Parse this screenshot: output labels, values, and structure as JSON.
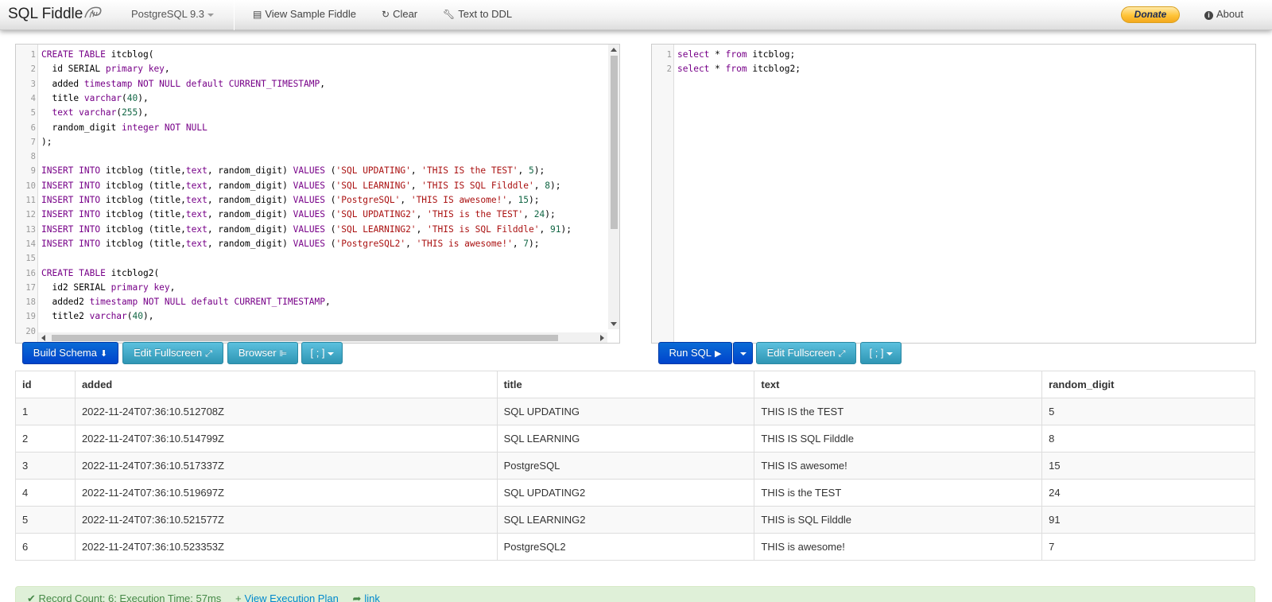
{
  "navbar": {
    "brand": "SQL Fiddle",
    "db_version": "PostgreSQL 9.3",
    "view_sample": "View Sample Fiddle",
    "clear": "Clear",
    "text_to_ddl": "Text to DDL",
    "donate": "Donate",
    "about": "About"
  },
  "schema_editor": {
    "lines": [
      {
        "n": "1",
        "t": [
          [
            "kw",
            "CREATE TABLE "
          ],
          [
            "",
            "itcblog("
          ]
        ]
      },
      {
        "n": "2",
        "t": [
          [
            "",
            "  id SERIAL "
          ],
          [
            "kw",
            "primary key"
          ],
          [
            "",
            ","
          ]
        ]
      },
      {
        "n": "3",
        "t": [
          [
            "",
            "  added "
          ],
          [
            "kw",
            "timestamp NOT NULL default CURRENT_TIMESTAMP"
          ],
          [
            "",
            ","
          ]
        ]
      },
      {
        "n": "4",
        "t": [
          [
            "",
            "  title "
          ],
          [
            "kw",
            "varchar"
          ],
          [
            "",
            "("
          ],
          [
            "nm",
            "40"
          ],
          [
            "",
            "),"
          ]
        ]
      },
      {
        "n": "5",
        "t": [
          [
            "",
            "  "
          ],
          [
            "kw",
            "text varchar"
          ],
          [
            "",
            "("
          ],
          [
            "nm",
            "255"
          ],
          [
            "",
            "),"
          ]
        ]
      },
      {
        "n": "6",
        "t": [
          [
            "",
            "  random_digit "
          ],
          [
            "kw",
            "integer NOT NULL"
          ]
        ]
      },
      {
        "n": "7",
        "t": [
          [
            "",
            ");"
          ]
        ]
      },
      {
        "n": "8",
        "t": [
          [
            "",
            ""
          ]
        ]
      },
      {
        "n": "9",
        "t": [
          [
            "kw",
            "INSERT INTO "
          ],
          [
            "",
            "itcblog (title,"
          ],
          [
            "kw",
            "text"
          ],
          [
            "",
            ", random_digit) "
          ],
          [
            "kw",
            "VALUES "
          ],
          [
            "",
            "("
          ],
          [
            "st",
            "'SQL UPDATING'"
          ],
          [
            "",
            ", "
          ],
          [
            "st",
            "'THIS IS the TEST'"
          ],
          [
            "",
            ", "
          ],
          [
            "nm",
            "5"
          ],
          [
            "",
            ");"
          ]
        ]
      },
      {
        "n": "10",
        "t": [
          [
            "kw",
            "INSERT INTO "
          ],
          [
            "",
            "itcblog (title,"
          ],
          [
            "kw",
            "text"
          ],
          [
            "",
            ", random_digit) "
          ],
          [
            "kw",
            "VALUES "
          ],
          [
            "",
            "("
          ],
          [
            "st",
            "'SQL LEARNING'"
          ],
          [
            "",
            ", "
          ],
          [
            "st",
            "'THIS IS SQL Filddle'"
          ],
          [
            "",
            ", "
          ],
          [
            "nm",
            "8"
          ],
          [
            "",
            ");"
          ]
        ]
      },
      {
        "n": "11",
        "t": [
          [
            "kw",
            "INSERT INTO "
          ],
          [
            "",
            "itcblog (title,"
          ],
          [
            "kw",
            "text"
          ],
          [
            "",
            ", random_digit) "
          ],
          [
            "kw",
            "VALUES "
          ],
          [
            "",
            "("
          ],
          [
            "st",
            "'PostgreSQL'"
          ],
          [
            "",
            ", "
          ],
          [
            "st",
            "'THIS IS awesome!'"
          ],
          [
            "",
            ", "
          ],
          [
            "nm",
            "15"
          ],
          [
            "",
            ");"
          ]
        ]
      },
      {
        "n": "12",
        "t": [
          [
            "kw",
            "INSERT INTO "
          ],
          [
            "",
            "itcblog (title,"
          ],
          [
            "kw",
            "text"
          ],
          [
            "",
            ", random_digit) "
          ],
          [
            "kw",
            "VALUES "
          ],
          [
            "",
            "("
          ],
          [
            "st",
            "'SQL UPDATING2'"
          ],
          [
            "",
            ", "
          ],
          [
            "st",
            "'THIS is the TEST'"
          ],
          [
            "",
            ", "
          ],
          [
            "nm",
            "24"
          ],
          [
            "",
            ");"
          ]
        ]
      },
      {
        "n": "13",
        "t": [
          [
            "kw",
            "INSERT INTO "
          ],
          [
            "",
            "itcblog (title,"
          ],
          [
            "kw",
            "text"
          ],
          [
            "",
            ", random_digit) "
          ],
          [
            "kw",
            "VALUES "
          ],
          [
            "",
            "("
          ],
          [
            "st",
            "'SQL LEARNING2'"
          ],
          [
            "",
            ", "
          ],
          [
            "st",
            "'THIS is SQL Filddle'"
          ],
          [
            "",
            ", "
          ],
          [
            "nm",
            "91"
          ],
          [
            "",
            ");"
          ]
        ]
      },
      {
        "n": "14",
        "t": [
          [
            "kw",
            "INSERT INTO "
          ],
          [
            "",
            "itcblog (title,"
          ],
          [
            "kw",
            "text"
          ],
          [
            "",
            ", random_digit) "
          ],
          [
            "kw",
            "VALUES "
          ],
          [
            "",
            "("
          ],
          [
            "st",
            "'PostgreSQL2'"
          ],
          [
            "",
            ", "
          ],
          [
            "st",
            "'THIS is awesome!'"
          ],
          [
            "",
            ", "
          ],
          [
            "nm",
            "7"
          ],
          [
            "",
            ");"
          ]
        ]
      },
      {
        "n": "15",
        "t": [
          [
            "",
            ""
          ]
        ]
      },
      {
        "n": "16",
        "t": [
          [
            "kw",
            "CREATE TABLE "
          ],
          [
            "",
            "itcblog2("
          ]
        ]
      },
      {
        "n": "17",
        "t": [
          [
            "",
            "  id2 SERIAL "
          ],
          [
            "kw",
            "primary key"
          ],
          [
            "",
            ","
          ]
        ]
      },
      {
        "n": "18",
        "t": [
          [
            "",
            "  added2 "
          ],
          [
            "kw",
            "timestamp NOT NULL default CURRENT_TIMESTAMP"
          ],
          [
            "",
            ","
          ]
        ]
      },
      {
        "n": "19",
        "t": [
          [
            "",
            "  title2 "
          ],
          [
            "kw",
            "varchar"
          ],
          [
            "",
            "("
          ],
          [
            "nm",
            "40"
          ],
          [
            "",
            "),"
          ]
        ]
      },
      {
        "n": "20",
        "t": [
          [
            "",
            ""
          ]
        ]
      }
    ]
  },
  "query_editor": {
    "lines": [
      {
        "n": "1",
        "t": [
          [
            "kw",
            "select"
          ],
          [
            "",
            " * "
          ],
          [
            "kw",
            "from"
          ],
          [
            "",
            " itcblog;"
          ]
        ]
      },
      {
        "n": "2",
        "t": [
          [
            "kw",
            "select"
          ],
          [
            "",
            " * "
          ],
          [
            "kw",
            "from"
          ],
          [
            "",
            " itcblog2;"
          ]
        ]
      }
    ]
  },
  "buttons": {
    "build_schema": "Build Schema",
    "edit_fullscreen": "Edit Fullscreen",
    "browser": "Browser",
    "delimiter": "[ ; ]",
    "run_sql": "Run SQL",
    "edit_fullscreen_2": "Edit Fullscreen",
    "delimiter_2": "[ ; ]"
  },
  "results": {
    "columns": [
      "id",
      "added",
      "title",
      "text",
      "random_digit"
    ],
    "rows": [
      [
        "1",
        "2022-11-24T07:36:10.512708Z",
        "SQL UPDATING",
        "THIS IS the TEST",
        "5"
      ],
      [
        "2",
        "2022-11-24T07:36:10.514799Z",
        "SQL LEARNING",
        "THIS IS SQL Filddle",
        "8"
      ],
      [
        "3",
        "2022-11-24T07:36:10.517337Z",
        "PostgreSQL",
        "THIS IS awesome!",
        "15"
      ],
      [
        "4",
        "2022-11-24T07:36:10.519697Z",
        "SQL UPDATING2",
        "THIS is the TEST",
        "24"
      ],
      [
        "5",
        "2022-11-24T07:36:10.521577Z",
        "SQL LEARNING2",
        "THIS is SQL Filddle",
        "91"
      ],
      [
        "6",
        "2022-11-24T07:36:10.523353Z",
        "PostgreSQL2",
        "THIS is awesome!",
        "7"
      ]
    ]
  },
  "status": {
    "record_info": "Record Count: 6; Execution Time: 57ms",
    "view_plan": "View Execution Plan",
    "link": "link"
  }
}
